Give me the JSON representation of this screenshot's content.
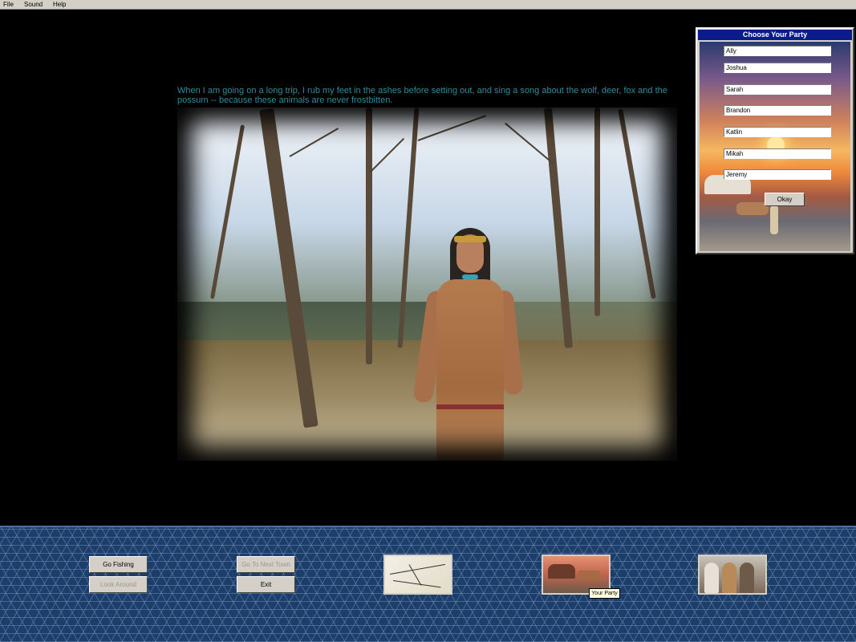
{
  "menu": {
    "items": [
      {
        "label": "File"
      },
      {
        "label": "Sound"
      },
      {
        "label": "Help"
      }
    ]
  },
  "quote": {
    "text": "When I am going on a long trip, I rub my feet in the ashes before setting out, and sing a song about the wolf, deer, fox and the possum -- because these animals are never frostbitten."
  },
  "party_dialog": {
    "title": "Choose Your Party",
    "members": [
      "Ally",
      "Joshua",
      "Sarah",
      "Brandon",
      "Katlin",
      "Mikah",
      "Jeremy"
    ],
    "okay_label": "Okay"
  },
  "toolbar": {
    "go_fishing": "Go Fishing",
    "look_around": "Look Around",
    "go_next_town": "Go To Next Town",
    "exit": "Exit",
    "tooltip": "Your Party"
  },
  "colors": {
    "quote_text": "#2e8b9a",
    "dialog_title_bg": "#0a1c8c",
    "toolbar_bg": "#1e3e6a",
    "button_face": "#d4d0c8",
    "tooltip_bg": "#ffffe1"
  },
  "icons": {
    "map": "map-thumbnail-icon",
    "wagon": "wagon-party-icon",
    "people": "characters-icon"
  }
}
